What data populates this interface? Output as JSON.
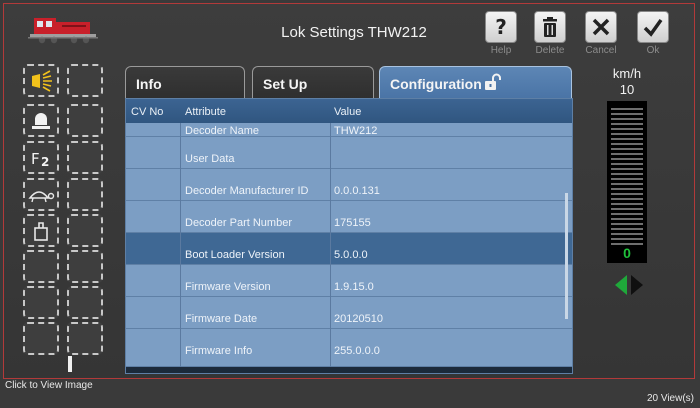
{
  "header": {
    "title": "Lok Settings THW212"
  },
  "toolbar": [
    {
      "label": "Help",
      "icon": "help-icon"
    },
    {
      "label": "Delete",
      "icon": "trash-icon"
    },
    {
      "label": "Cancel",
      "icon": "close-icon"
    },
    {
      "label": "Ok",
      "icon": "check-icon"
    }
  ],
  "functions": [
    {
      "icon": "headlight-icon"
    },
    {
      "icon": "bell-icon"
    },
    {
      "icon": "f2-icon"
    },
    {
      "icon": "turtle-icon"
    },
    {
      "icon": "weight-icon"
    }
  ],
  "tabs": [
    {
      "label": "Info"
    },
    {
      "label": "Set Up"
    },
    {
      "label": "Configuration",
      "icon": "unlock-icon"
    }
  ],
  "table": {
    "columns": [
      "CV No",
      "Attribute",
      "Value"
    ],
    "rows": [
      {
        "cv": "",
        "attribute": "Decoder Name",
        "value": "THW212"
      },
      {
        "cv": "",
        "attribute": "User Data",
        "value": ""
      },
      {
        "cv": "",
        "attribute": "Decoder Manufacturer ID",
        "value": "0.0.0.131"
      },
      {
        "cv": "",
        "attribute": "Decoder Part Number",
        "value": "175155"
      },
      {
        "cv": "",
        "attribute": "Boot Loader Version",
        "value": "5.0.0.0",
        "selected": true
      },
      {
        "cv": "",
        "attribute": "Firmware Version",
        "value": "1.9.15.0"
      },
      {
        "cv": "",
        "attribute": "Firmware Date",
        "value": "20120510"
      },
      {
        "cv": "",
        "attribute": "Firmware Info",
        "value": "255.0.0.0"
      }
    ]
  },
  "speed": {
    "unit": "km/h",
    "max": "10",
    "current": "0"
  },
  "status": {
    "left": "Click to View Image",
    "right": "20 View(s)"
  },
  "colors": {
    "accent": "#4a74a6",
    "speed_readout": "#1fbf3a",
    "frame_border": "#b23a3a"
  }
}
